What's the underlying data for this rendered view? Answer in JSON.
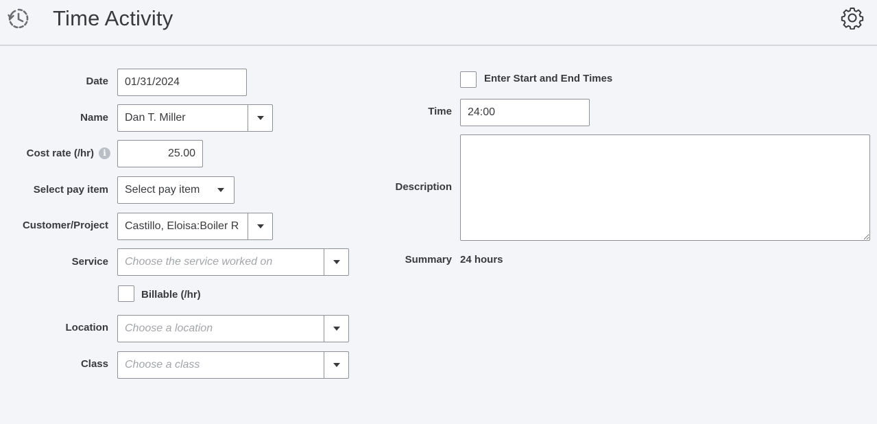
{
  "header": {
    "title": "Time Activity",
    "icon": "clock-history-icon",
    "settings_icon": "gear-icon"
  },
  "form": {
    "date": {
      "label": "Date",
      "value": "01/31/2024"
    },
    "name": {
      "label": "Name",
      "value": "Dan T. Miller"
    },
    "cost_rate": {
      "label": "Cost rate (/hr)",
      "value": "25.00",
      "info_icon": "info-icon"
    },
    "pay_item": {
      "label": "Select pay item",
      "value": "Select pay item"
    },
    "customer": {
      "label": "Customer/Project",
      "value": "Castillo, Eloisa:Boiler R"
    },
    "service": {
      "label": "Service",
      "placeholder": "Choose the service worked on"
    },
    "billable": {
      "label": "Billable (/hr)",
      "checked": false
    },
    "location": {
      "label": "Location",
      "placeholder": "Choose a location"
    },
    "class": {
      "label": "Class",
      "placeholder": "Choose a class"
    },
    "start_end": {
      "label": "Enter Start and End Times",
      "checked": false
    },
    "time": {
      "label": "Time",
      "value": "24:00"
    },
    "description": {
      "label": "Description",
      "value": ""
    },
    "summary": {
      "label": "Summary",
      "value": "24 hours"
    }
  },
  "colors": {
    "background": "#f4f5f8",
    "border": "#8d9096",
    "text": "#393a3d",
    "placeholder": "#a3a5aa"
  }
}
